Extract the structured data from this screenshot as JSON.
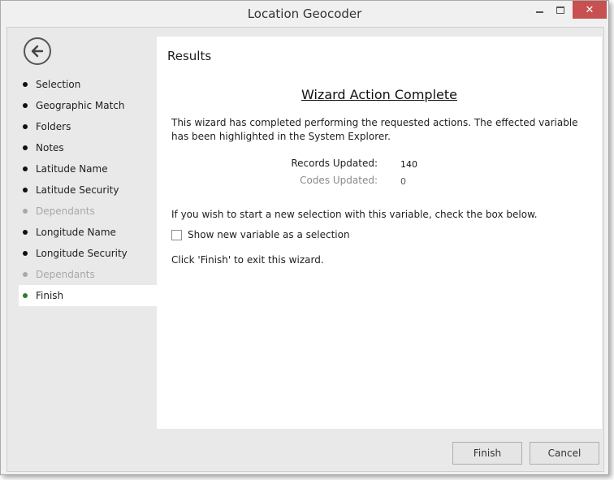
{
  "window": {
    "title": "Location Geocoder",
    "controls": {
      "minimize_icon": "minimize-icon",
      "maximize_icon": "maximize-icon",
      "close_icon": "close-icon",
      "close_glyph": "✕"
    }
  },
  "sidebar": {
    "back_icon": "back-arrow-icon",
    "items": [
      {
        "label": "Selection",
        "state": "done"
      },
      {
        "label": "Geographic Match",
        "state": "done"
      },
      {
        "label": "Folders",
        "state": "done"
      },
      {
        "label": "Notes",
        "state": "done"
      },
      {
        "label": "Latitude Name",
        "state": "done"
      },
      {
        "label": "Latitude Security",
        "state": "done"
      },
      {
        "label": "Dependants",
        "state": "disabled"
      },
      {
        "label": "Longitude Name",
        "state": "done"
      },
      {
        "label": "Longitude Security",
        "state": "done"
      },
      {
        "label": "Dependants",
        "state": "disabled"
      },
      {
        "label": "Finish",
        "state": "active"
      }
    ]
  },
  "main": {
    "title": "Results",
    "heading": "Wizard Action Complete",
    "description": "This wizard has completed performing the requested actions. The effected variable has been highlighted in the System Explorer.",
    "stats": {
      "records_label": "Records Updated:",
      "records_value": "140",
      "codes_label": "Codes Updated:",
      "codes_value": "0"
    },
    "instruction": "If you wish to start a new selection with this variable, check the box below.",
    "checkbox": {
      "label": "Show new variable as a selection",
      "checked": false
    },
    "exit_note": "Click 'Finish' to exit this wizard."
  },
  "footer": {
    "finish_label": "Finish",
    "cancel_label": "Cancel"
  },
  "colors": {
    "close_button": "#c75050",
    "active_dot": "#2e7d32",
    "disabled_text": "#a8a8a8"
  }
}
